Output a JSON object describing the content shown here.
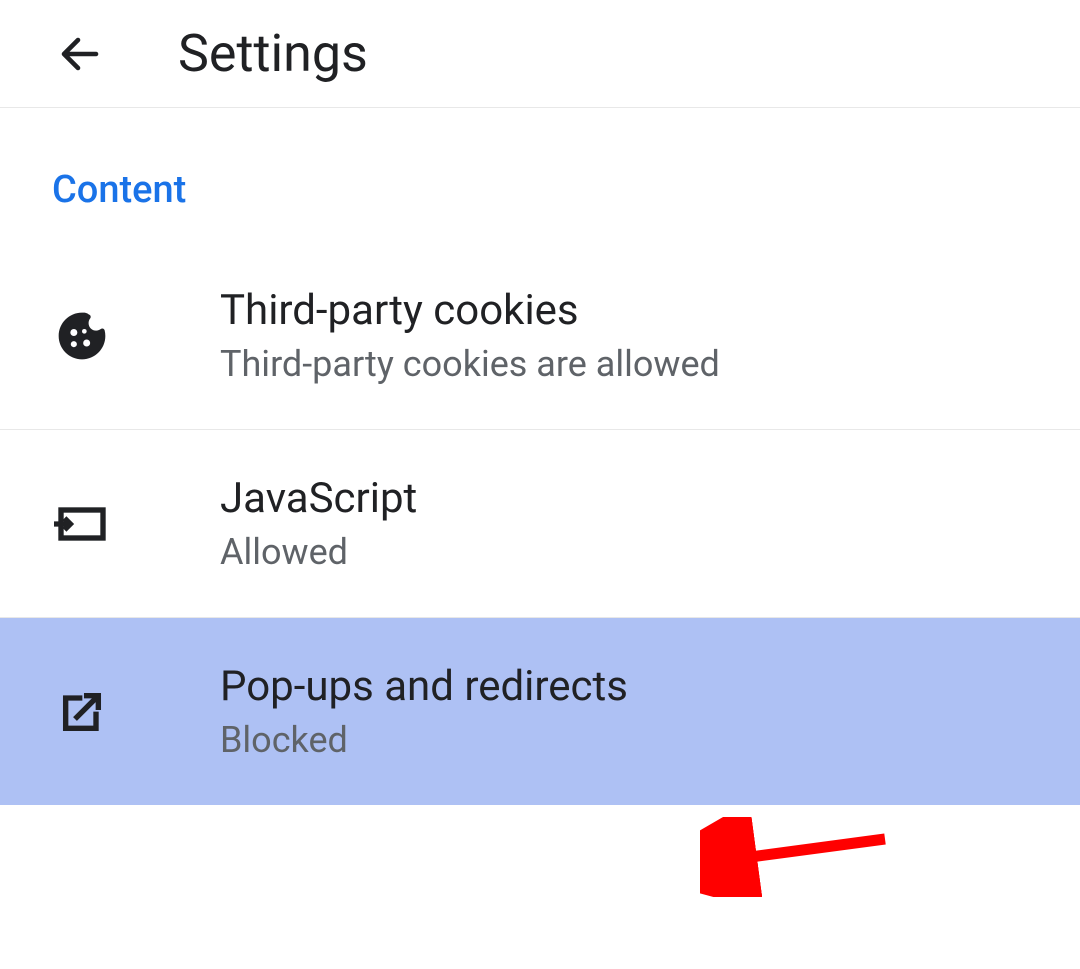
{
  "header": {
    "title": "Settings"
  },
  "section": {
    "label": "Content"
  },
  "items": [
    {
      "title": "Third-party cookies",
      "subtitle": "Third-party cookies are allowed"
    },
    {
      "title": "JavaScript",
      "subtitle": "Allowed"
    },
    {
      "title": "Pop-ups and redirects",
      "subtitle": "Blocked"
    }
  ]
}
